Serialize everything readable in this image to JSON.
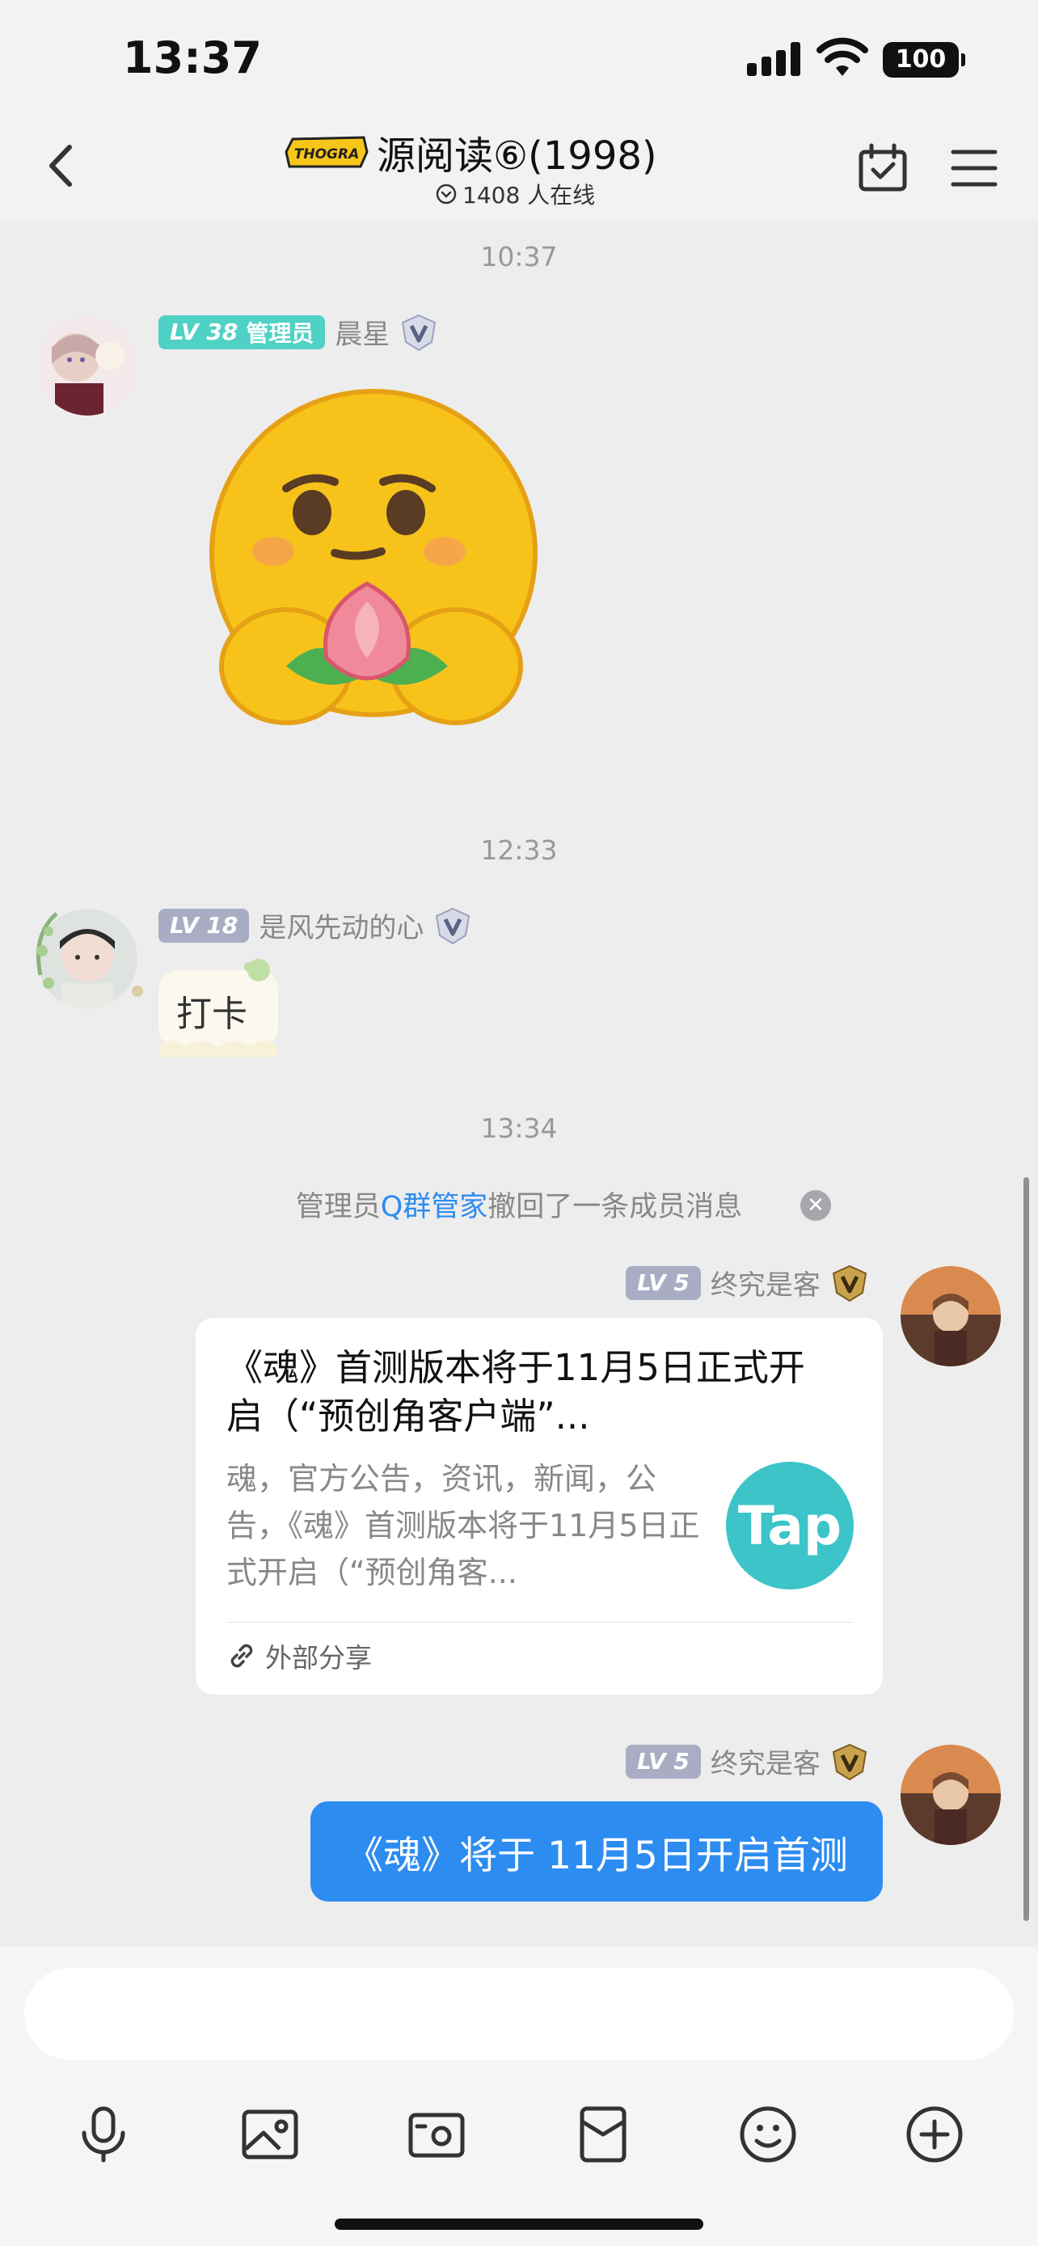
{
  "status_bar": {
    "time": "13:37",
    "battery": "100"
  },
  "nav": {
    "group_logo_text": "THOGRA",
    "group_title": "源阅读⑥(1998)",
    "online_count": "1408 人在线"
  },
  "timestamps": [
    "10:37",
    "12:33",
    "13:34"
  ],
  "messages": [
    {
      "level": "LV 38",
      "role": "管理员",
      "sender": "晨星",
      "type": "sticker-emoji"
    },
    {
      "level": "LV 18",
      "sender": "是风先动的心",
      "text": "打卡"
    },
    {
      "level": "LV 5",
      "sender": "终究是客",
      "card": {
        "title": "《魂》首测版本将于11月5日正式开启（“预创角客户端”...",
        "desc": "魂，官方公告，资讯，新闻，公告，《魂》首测版本将于11月5日正式开启（“预创角客...",
        "logo": "Tap",
        "footer": "外部分享"
      }
    },
    {
      "level": "LV 5",
      "sender": "终究是客",
      "text": "《魂》将于 11月5日开启首测"
    }
  ],
  "recall": {
    "prefix": "管理员 ",
    "admin": "Q群管家",
    "suffix": "撤回了一条成员消息"
  },
  "colors": {
    "accent": "#2d8cf0",
    "admin_badge": "#4fd1c5",
    "lv_badge": "#a9adc4",
    "tap": "#3cc4c8"
  },
  "tools": [
    "mic-icon",
    "image-icon",
    "camera-icon",
    "red-packet-icon",
    "emoji-icon",
    "plus-icon"
  ]
}
